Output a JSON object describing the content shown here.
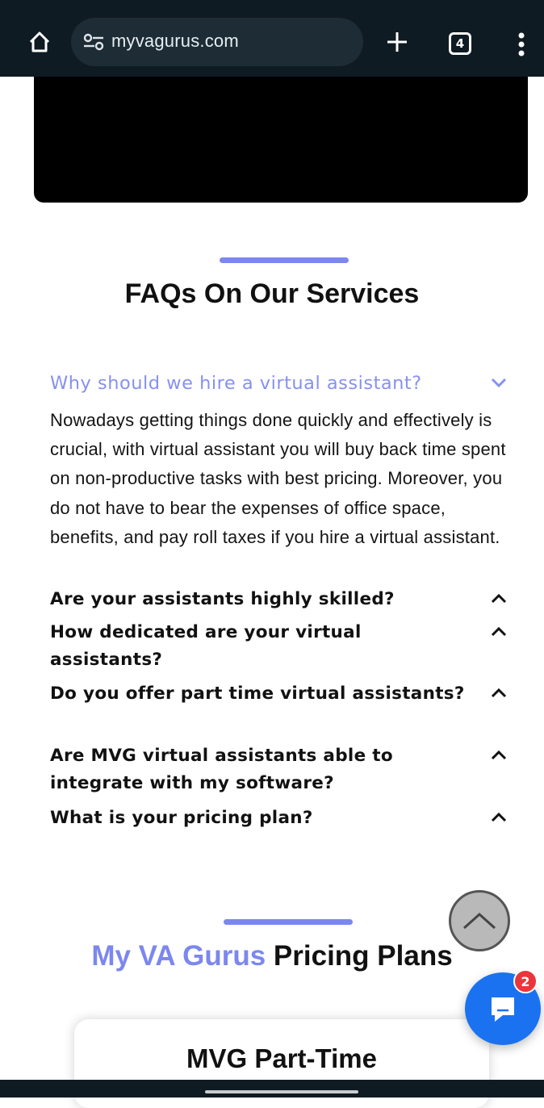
{
  "browser": {
    "url": "myvagurus.com",
    "tab_count": "4",
    "icons": [
      "home-icon",
      "site-settings-icon",
      "new-tab-icon",
      "tab-switcher-icon",
      "more-options-icon"
    ]
  },
  "faq": {
    "title": "FAQs On Our Services",
    "accent_color": "#7c87ee",
    "open_question": "Why should we hire a virtual assistant?",
    "open_answer": "Nowadays getting things done quickly and effectively is crucial, with virtual assistant you will buy back time spent on non-productive tasks with best pricing. Moreover, you do not have to bear the expenses of office space, benefits, and pay roll taxes if you hire a virtual assistant.",
    "questions": [
      "Are your assistants highly skilled?",
      "How dedicated are your virtual assistants?",
      "Do you offer part time virtual assistants?",
      "Are MVG virtual assistants able to integrate with my software?",
      "What is your pricing plan?"
    ]
  },
  "pricing": {
    "brand": "My VA Gurus",
    "title_rest": "Pricing Plans",
    "card_title": "MVG Part-Time"
  },
  "chat": {
    "badge_count": "2",
    "button_color": "#1a72f0"
  }
}
